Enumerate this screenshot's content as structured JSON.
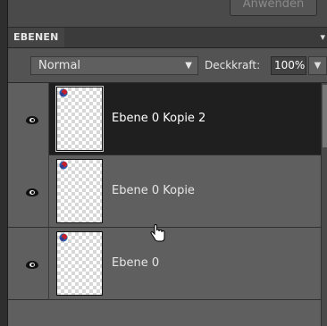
{
  "toolbar": {
    "apply_label": "Anwenden"
  },
  "panel": {
    "tab_label": "EBENEN",
    "menu_icon": "panel-menu-arrow",
    "blend_mode": "Normal",
    "opacity_label": "Deckkraft:",
    "opacity_value": "100%"
  },
  "layers": [
    {
      "name": "Ebene 0 Kopie 2",
      "selected": true,
      "visible": true
    },
    {
      "name": "Ebene 0 Kopie",
      "selected": false,
      "visible": true
    },
    {
      "name": "Ebene 0",
      "selected": false,
      "visible": true
    }
  ],
  "colors": {
    "selected_row": "#1f1f1f",
    "panel_bg": "#5f5f5f"
  }
}
